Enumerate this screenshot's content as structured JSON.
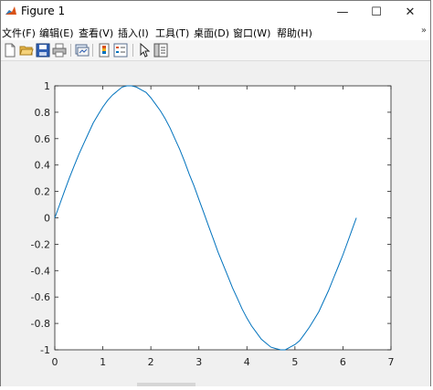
{
  "window": {
    "title": "Figure 1",
    "minimize_glyph": "—",
    "maximize_glyph": "☐",
    "close_glyph": "✕"
  },
  "menu": {
    "items": [
      {
        "label": "文件(F)"
      },
      {
        "label": "编辑(E)"
      },
      {
        "label": "查看(V)"
      },
      {
        "label": "插入(I)"
      },
      {
        "label": "工具(T)"
      },
      {
        "label": "桌面(D)"
      },
      {
        "label": "窗口(W)"
      },
      {
        "label": "帮助(H)"
      }
    ],
    "overflow_glyph": "»"
  },
  "toolbar": {
    "icons": [
      "new-figure-icon",
      "open-file-icon",
      "save-icon",
      "print-icon",
      "link-plot-icon",
      "insert-colorbar-icon",
      "insert-legend-icon",
      "edit-plot-arrow-icon",
      "property-editor-icon"
    ]
  },
  "colors": {
    "line": "#0072BD",
    "axes": "#262626"
  },
  "chart_data": {
    "type": "line",
    "title": "",
    "xlabel": "",
    "ylabel": "",
    "xlim": [
      0,
      7
    ],
    "ylim": [
      -1,
      1
    ],
    "xticks": [
      0,
      1,
      2,
      3,
      4,
      5,
      6,
      7
    ],
    "yticks": [
      -1,
      -0.8,
      -0.6,
      -0.4,
      -0.2,
      0,
      0.2,
      0.4,
      0.6,
      0.8,
      1
    ],
    "xtick_labels": [
      "0",
      "1",
      "2",
      "3",
      "4",
      "5",
      "6",
      "7"
    ],
    "ytick_labels": [
      "-1",
      "-0.8",
      "-0.6",
      "-0.4",
      "-0.2",
      "0",
      "0.2",
      "0.4",
      "0.6",
      "0.8",
      "1"
    ],
    "grid": false,
    "series": [
      {
        "x": [
          0,
          0.1,
          0.2,
          0.3,
          0.4,
          0.5,
          0.6,
          0.7,
          0.8,
          0.9,
          1.0,
          1.1,
          1.2,
          1.3,
          1.4,
          1.5,
          1.6,
          1.7,
          1.8,
          1.9,
          2.0,
          2.1,
          2.2,
          2.3,
          2.4,
          2.5,
          2.6,
          2.7,
          2.8,
          2.9,
          3.0,
          3.1,
          3.2,
          3.3,
          3.4,
          3.5,
          3.6,
          3.7,
          3.8,
          3.9,
          4.0,
          4.1,
          4.2,
          4.3,
          4.4,
          4.5,
          4.6,
          4.7,
          4.8,
          4.9,
          5.0,
          5.1,
          5.2,
          5.3,
          5.4,
          5.5,
          5.6,
          5.7,
          5.8,
          5.9,
          6.0,
          6.1,
          6.2,
          6.28
        ],
        "y": [
          0,
          0.1,
          0.2,
          0.3,
          0.39,
          0.48,
          0.56,
          0.64,
          0.72,
          0.78,
          0.84,
          0.89,
          0.93,
          0.96,
          0.99,
          1.0,
          1.0,
          0.99,
          0.97,
          0.95,
          0.91,
          0.86,
          0.81,
          0.75,
          0.68,
          0.6,
          0.52,
          0.43,
          0.33,
          0.24,
          0.14,
          0.04,
          -0.06,
          -0.16,
          -0.26,
          -0.35,
          -0.44,
          -0.53,
          -0.61,
          -0.69,
          -0.76,
          -0.82,
          -0.87,
          -0.92,
          -0.95,
          -0.98,
          -0.99,
          -1.0,
          -1.0,
          -0.98,
          -0.96,
          -0.93,
          -0.88,
          -0.83,
          -0.77,
          -0.71,
          -0.63,
          -0.55,
          -0.46,
          -0.37,
          -0.28,
          -0.18,
          -0.08,
          0
        ]
      }
    ]
  }
}
